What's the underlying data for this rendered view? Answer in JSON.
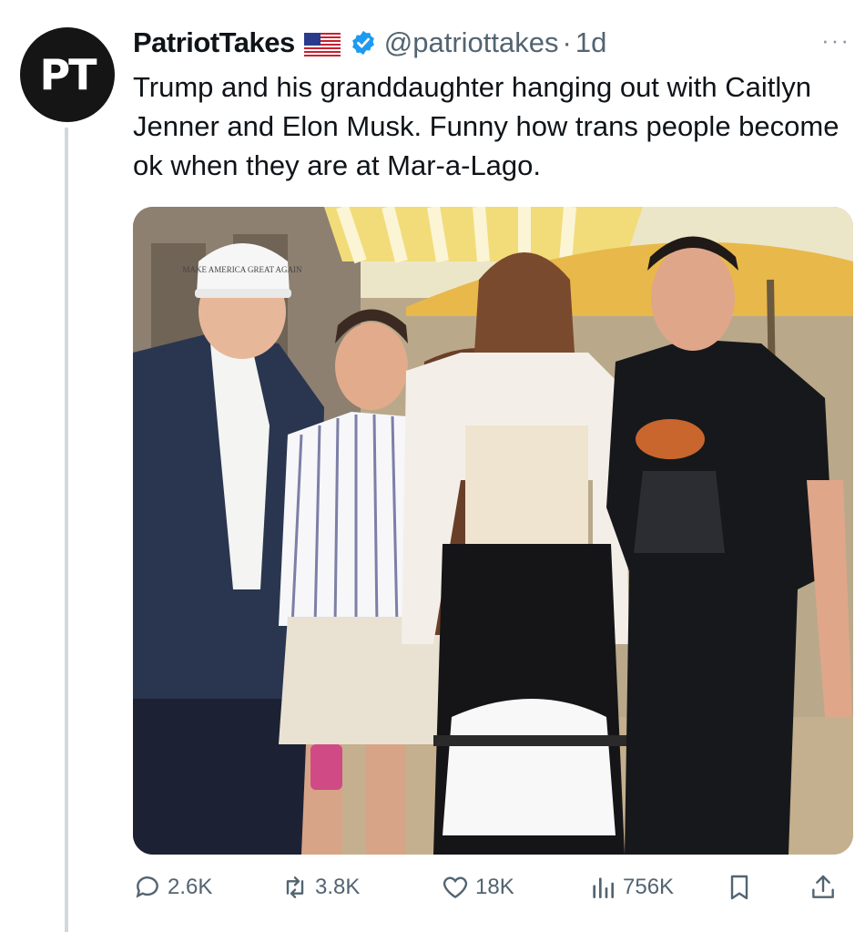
{
  "account": {
    "avatar_text": "PT",
    "display_name": "PatriotTakes",
    "handle": "@patriottakes",
    "separator": "·",
    "time": "1d",
    "flag_icon": "us-flag-icon",
    "verified_icon": "verified-badge-icon"
  },
  "tweet": {
    "text": "Trump and his granddaughter hanging out with Caitlyn Jenner and Elon Musk. Funny how trans people become ok when they are at Mar-a-Lago."
  },
  "media": {
    "hat_text": "MAKE AMERICA GREAT AGAIN"
  },
  "actions": {
    "replies": "2.6K",
    "reposts": "3.8K",
    "likes": "18K",
    "views": "756K"
  },
  "more_menu": "···",
  "colors": {
    "text": "#0f1419",
    "secondary": "#536471",
    "verified": "#1d9bf0",
    "thread_line": "#cfd9de"
  }
}
